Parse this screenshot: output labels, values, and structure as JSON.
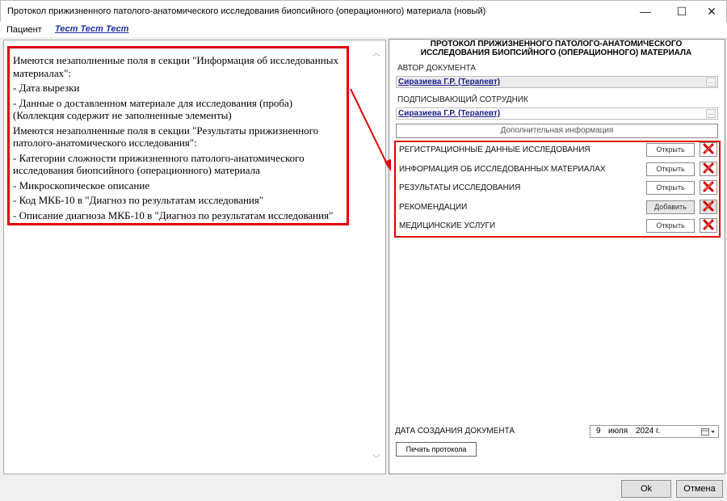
{
  "window": {
    "title": "Протокол прижизненного патолого-анатомического исследования биопсийного (операционного) материала (новый)",
    "minimize_glyph": "—",
    "maximize_glyph": "☐",
    "close_glyph": "✕"
  },
  "patient": {
    "label": "Пациент",
    "name": "Тест Тест Тест"
  },
  "errors": [
    "Имеются незаполненные поля в секции \"Информация об исследованных материалах\":",
    "- Дата вырезки",
    "- Данные о доставленном материале для исследования (проба) (Коллекция содержит не заполненные элементы)",
    "Имеются незаполненные поля в секции \"Результаты прижизненного патолого-анатомического исследования\":",
    "- Категории сложности прижизненного патолого-анатомического исследования биопсийного (операционного) материала",
    "- Микроскопическое описание",
    "- Код МКБ-10 в \"Диагноз по результатам исследования\"",
    "- Описание диагноза МКБ-10 в \"Диагноз по результатам исследования\""
  ],
  "protocol": {
    "title_line1": "ПРОТОКОЛ ПРИЖИЗНЕННОГО ПАТОЛОГО-АНАТОМИЧЕСКОГО",
    "title_line2": "ИССЛЕДОВАНИЯ БИОПСИЙНОГО (ОПЕРАЦИОННОГО) МАТЕРИАЛА",
    "author_label": "АВТОР ДОКУМЕНТА",
    "author_value": "Сиразиева Г.Р. (Терапевт)",
    "signer_label": "ПОДПИСЫВАЮЩИЙ СОТРУДНИК",
    "signer_value": "Сиразиева Г.Р. (Терапевт)",
    "ellipsis": "...",
    "extra_info": "Дополнительная информация",
    "sections": [
      {
        "label": "РЕГИСТРАЦИОННЫЕ ДАННЫЕ ИССЛЕДОВАНИЯ",
        "action": "Открыть"
      },
      {
        "label": "ИНФОРМАЦИЯ ОБ ИССЛЕДОВАННЫХ МАТЕРИАЛАХ",
        "action": "Открыть"
      },
      {
        "label": "РЕЗУЛЬТАТЫ ИССЛЕДОВАНИЯ",
        "action": "Открыть"
      },
      {
        "label": "РЕКОМЕНДАЦИИ",
        "action": "Добавить"
      },
      {
        "label": "МЕДИЦИНСКИЕ УСЛУГИ",
        "action": "Открыть"
      }
    ],
    "date_label": "ДАТА СОЗДАНИЯ ДОКУМЕНТА",
    "date_day": "9",
    "date_month": "июля",
    "date_year": "2024 г.",
    "print_label": "Печать протокола"
  },
  "dialog": {
    "ok": "Ok",
    "cancel": "Отмена"
  },
  "colors": {
    "highlight": "#e00000",
    "link": "#1a2ea8",
    "delete": "#cc0000"
  }
}
